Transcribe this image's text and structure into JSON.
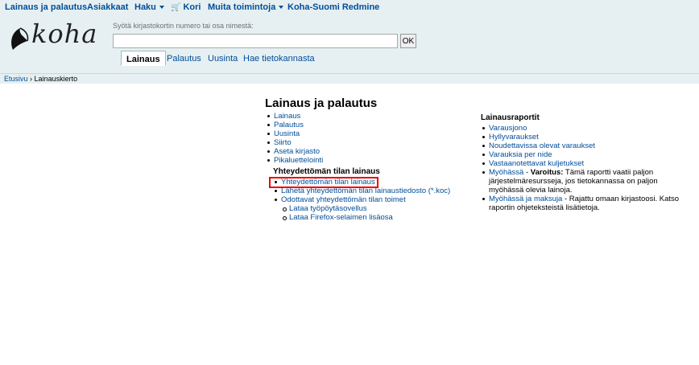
{
  "topnav": {
    "items": [
      {
        "label": "Lainaus ja palautus"
      },
      {
        "label": "Asiakkaat"
      },
      {
        "label": "Haku"
      },
      {
        "label": "Kori"
      },
      {
        "label": "Muita toimintoja"
      },
      {
        "label": "Koha-Suomi Redmine"
      }
    ]
  },
  "header": {
    "logo_text": "koha",
    "search_label": "Syötä kirjastokortin numero tai osa nimestä:",
    "search_value": "",
    "search_button": "OK"
  },
  "tabs": [
    {
      "label": "Lainaus"
    },
    {
      "label": "Palautus"
    },
    {
      "label": "Uusinta"
    },
    {
      "label": "Hae tietokannasta"
    }
  ],
  "breadcrumb": {
    "home": "Etusivu",
    "separator": "›",
    "current": "Lainauskierto"
  },
  "main": {
    "title": "Lainaus ja palautus",
    "links": [
      {
        "label": "Lainaus"
      },
      {
        "label": "Palautus"
      },
      {
        "label": "Uusinta"
      },
      {
        "label": "Siirto"
      },
      {
        "label": "Aseta kirjasto"
      },
      {
        "label": "Pikaluettelointi"
      }
    ],
    "offline_heading": "Yhteydettömän tilan lainaus",
    "offline_links": [
      {
        "label": "Yhteydettömän tilan lainaus"
      },
      {
        "label": "Lähetä yhteydettömän tilan lainaustiedosto (*.koc)"
      },
      {
        "label": "Odottavat yhteydettömän tilan toimet"
      }
    ],
    "offline_sub_links": [
      {
        "label": "Lataa työpöytäsovellus"
      },
      {
        "label": "Lataa Firefox-selaimen lisäosa"
      }
    ]
  },
  "reports": {
    "heading": "Lainausraportit",
    "links": [
      {
        "label": "Varausjono"
      },
      {
        "label": "Hyllyvaraukset"
      },
      {
        "label": "Noudettavissa olevat varaukset"
      },
      {
        "label": "Varauksia per nide"
      },
      {
        "label": "Vastaanotettavat kuljetukset"
      }
    ],
    "overdues": {
      "label": "Myöhässä",
      "dash": " - ",
      "warning_label": "Varoitus:",
      "warning_text": " Tämä raportti vaatii paljon järjestelmäresursseja, jos tietokannassa on paljon myöhässä olevia lainoja."
    },
    "fines": {
      "label": "Myöhässä ja maksuja",
      "text": " - Rajattu omaan kirjastoosi. Katso raportin ohjeteksteistä lisätietoja."
    }
  }
}
